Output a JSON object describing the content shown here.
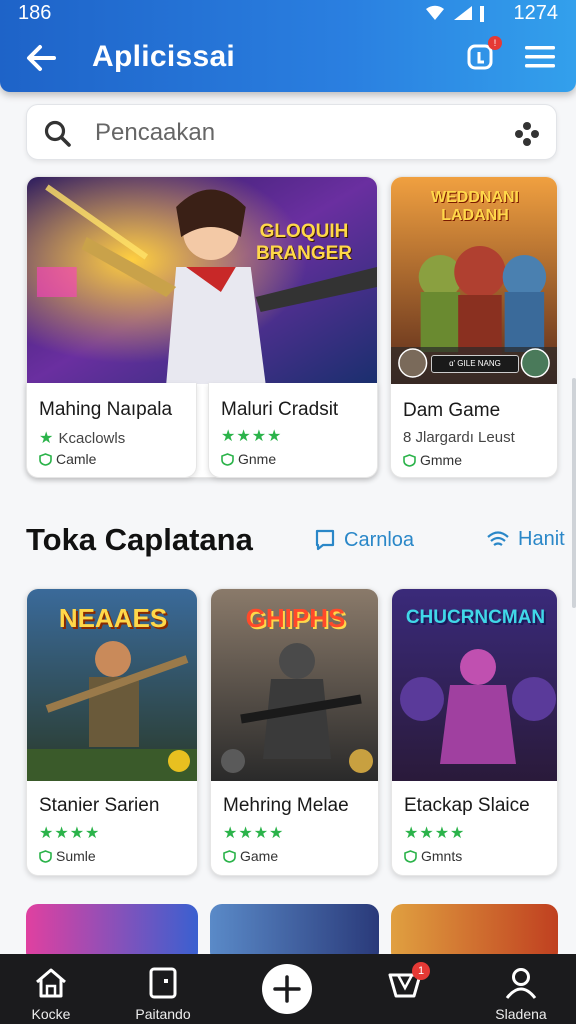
{
  "status_bar": {
    "time": "186",
    "clock": "1274"
  },
  "app_bar": {
    "title": "Aplicissai",
    "notification_count": "!"
  },
  "search": {
    "placeholder": "Pencaakan"
  },
  "featured": [
    {
      "title": "Mahing Naıpala",
      "subtitle": "Kcaclowls",
      "tag": "Camle",
      "art_text": "GLOQUIH BRANGER"
    },
    {
      "title": "Maluri Cradsit",
      "stars": "★★★★",
      "tag": "Gnme"
    },
    {
      "title": "Dam Game",
      "subtitle": "8 Jlargardı Leust",
      "tag": "Gmme",
      "art_text": "WEDDNANI LADANH",
      "art_footer": "ɑ' GILE NANG"
    }
  ],
  "section": {
    "title": "Toka Caplatana",
    "link1": "Carnloa",
    "link2": "Hanit"
  },
  "grid": [
    {
      "title": "Stanier Sarien",
      "stars": "★★★★",
      "tag": "Sumle",
      "art_text": "NEAAES"
    },
    {
      "title": "Mehring Melae",
      "stars": "★★★★",
      "tag": "Game",
      "art_text": "GHIPHS"
    },
    {
      "title": "Etackap Slaice",
      "stars": "★★★★",
      "tag": "Gmnts",
      "art_text": "CHUCRNCMAN"
    }
  ],
  "bottom_nav": [
    {
      "label": "Kocke",
      "icon": "home-icon"
    },
    {
      "label": "Paitando",
      "icon": "page-icon"
    },
    {
      "label": "",
      "icon": "plus-icon"
    },
    {
      "label": "",
      "icon": "basket-icon",
      "badge": "1"
    },
    {
      "label": "Sladena",
      "icon": "profile-icon"
    }
  ],
  "colors": {
    "app_bar": "#2a7fe0",
    "star_green": "#2bb34a",
    "link_blue": "#2a87c8",
    "nav_bg": "#1b1b1d"
  }
}
